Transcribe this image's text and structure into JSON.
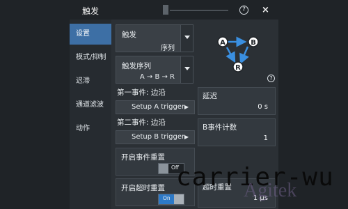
{
  "window": {
    "title": "触发",
    "help_symbol": "?",
    "close_symbol": "×"
  },
  "sidebar": {
    "items": [
      {
        "label": "设置",
        "active": true
      },
      {
        "label": "模式/抑制",
        "active": false
      },
      {
        "label": "迟滞",
        "active": false
      },
      {
        "label": "通道滤波",
        "active": false
      },
      {
        "label": "动作",
        "active": false
      }
    ]
  },
  "trigger": {
    "label": "触发",
    "value": "序列"
  },
  "sequence": {
    "label": "触发序列",
    "value": "A → B → R"
  },
  "diagram": {
    "node_a": "A",
    "node_b": "B",
    "node_r": "R",
    "help_symbol": "?"
  },
  "event1": {
    "label": "第一事件: 边沿",
    "button": "Setup A trigger"
  },
  "event2": {
    "label": "第二事件: 边沿",
    "button": "Setup B trigger"
  },
  "delay": {
    "label": "延迟",
    "value": "0 s"
  },
  "b_count": {
    "label": "B事件计数",
    "value": "1"
  },
  "event_reset": {
    "label": "开启事件重置",
    "state": "Off"
  },
  "timeout_reset": {
    "label": "开启超时重置",
    "state": "On"
  },
  "timeout": {
    "label": "超时重置",
    "value": "1 μs"
  },
  "watermarks": {
    "carrier": "carrier-wu",
    "agitek": "Agitek"
  },
  "colors": {
    "accent": "#3d6fa5",
    "toggle_on": "#2d79c7",
    "panel": "#2b3035"
  }
}
